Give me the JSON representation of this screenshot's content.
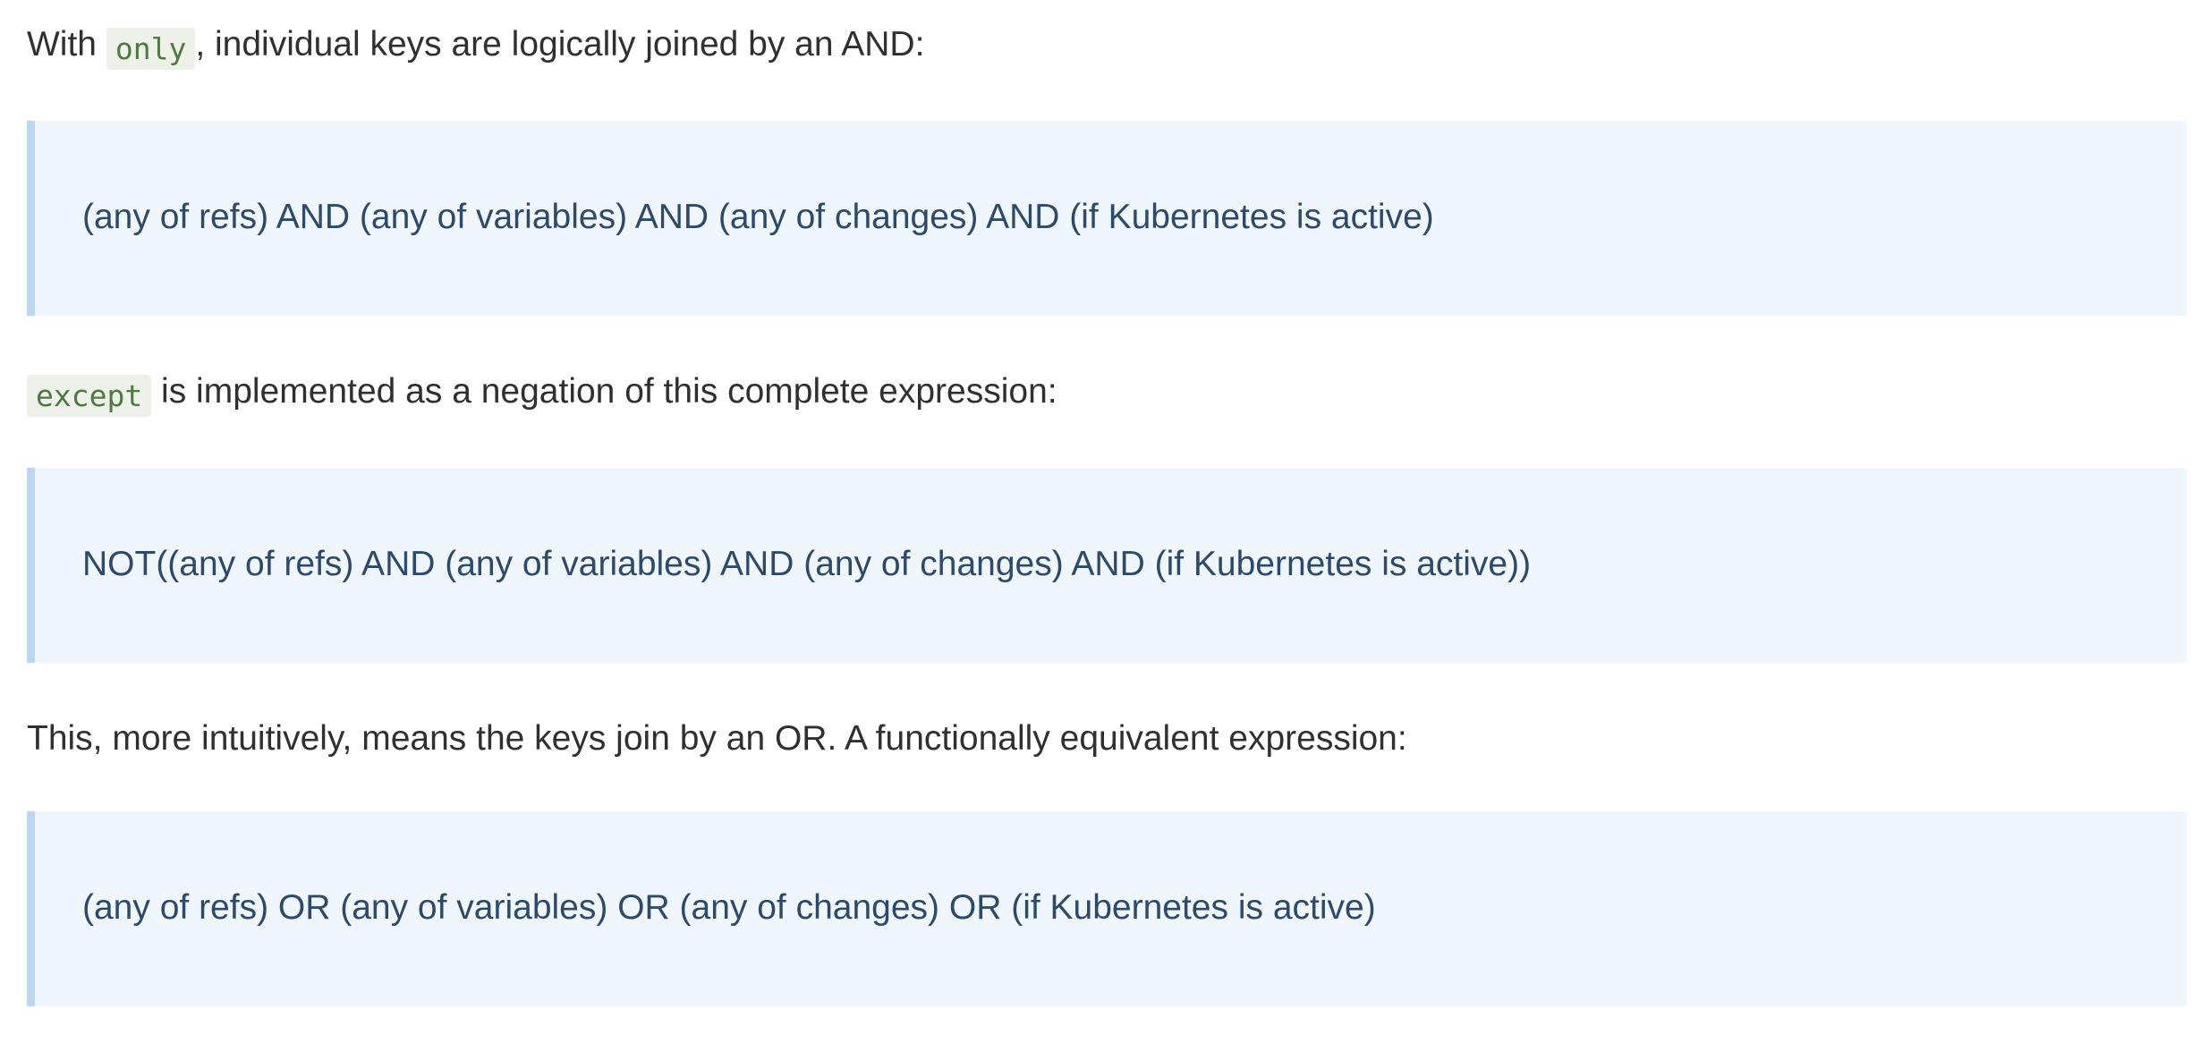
{
  "sections": [
    {
      "intro": {
        "before": "With ",
        "code": "only",
        "after": ", individual keys are logically joined by an AND:"
      },
      "expression": "(any of refs) AND (any of variables) AND (any of changes) AND (if Kubernetes is active)"
    },
    {
      "intro": {
        "before": "",
        "code": "except",
        "after": " is implemented as a negation of this complete expression:"
      },
      "expression": "NOT((any of refs) AND (any of variables) AND (any of changes) AND (if Kubernetes is active))"
    },
    {
      "intro": {
        "text": "This, more intuitively, means the keys join by an OR. A functionally equivalent expression:"
      },
      "expression": "(any of refs) OR (any of variables) OR (any of changes) OR (if Kubernetes is active)"
    }
  ]
}
